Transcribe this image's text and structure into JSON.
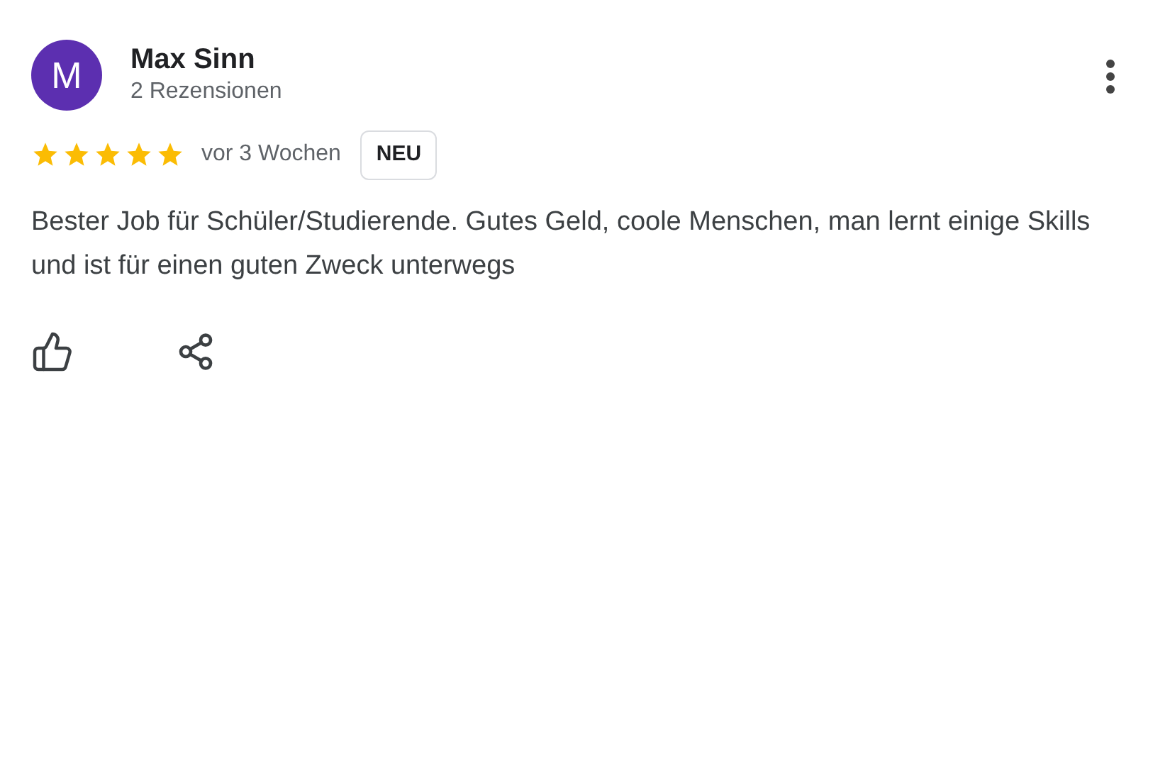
{
  "review": {
    "avatar_initial": "M",
    "author": "Max Sinn",
    "review_count": "2 Rezensionen",
    "stars": 5,
    "time": "vor 3 Wochen",
    "badge": "NEU",
    "text": "Bester Job für Schüler/Studierende. Gutes Geld, coole Menschen, man lernt einige Skills und ist für einen guten Zweck unterwegs"
  }
}
